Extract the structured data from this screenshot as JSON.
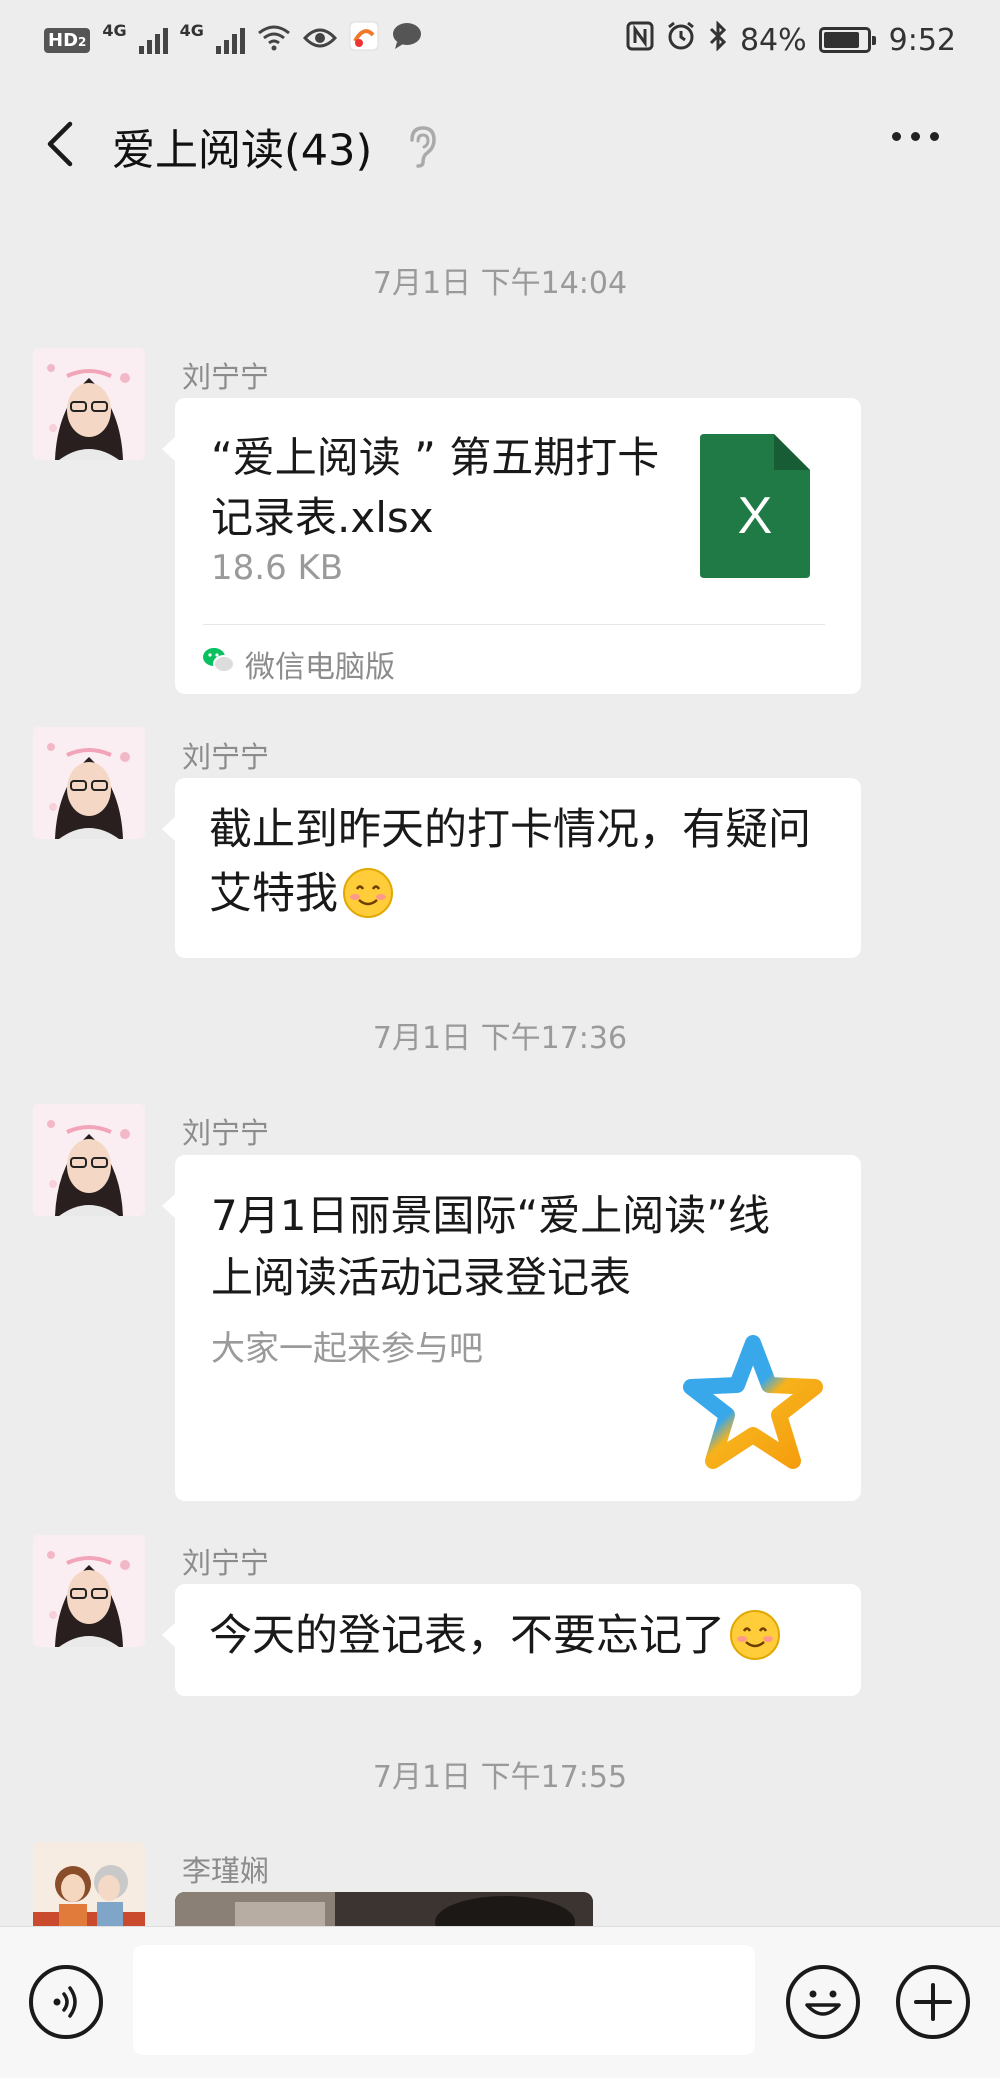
{
  "status_bar": {
    "network": "HD",
    "sim": "2",
    "signal_4g_1": "4G",
    "signal_4g_2": "4G",
    "battery": "84%",
    "time": "9:52"
  },
  "header": {
    "title": "爱上阅读(43)"
  },
  "timestamps": [
    "7月1日 下午14:04",
    "7月1日 下午17:36",
    "7月1日 下午17:55"
  ],
  "messages": [
    {
      "sender": "刘宁宁",
      "type": "file",
      "file_name": "“爱上阅读 ” 第五期打卡记录表.xlsx",
      "file_size": "18.6 KB",
      "file_icon_letter": "X",
      "source": "微信电脑版"
    },
    {
      "sender": "刘宁宁",
      "type": "text",
      "text": "截止到昨天的打卡情况，有疑问艾特我"
    },
    {
      "sender": "刘宁宁",
      "type": "link",
      "title": "7月1日丽景国际“爱上阅读”线上阅读活动记录登记表",
      "description": "大家一起来参与吧"
    },
    {
      "sender": "刘宁宁",
      "type": "text",
      "text": "今天的登记表，不要忘记了"
    },
    {
      "sender": "李瑾娴",
      "type": "image"
    }
  ],
  "colors": {
    "excel_green": "#1f7a45",
    "background": "#ededed",
    "wechat_green": "#07c160"
  }
}
